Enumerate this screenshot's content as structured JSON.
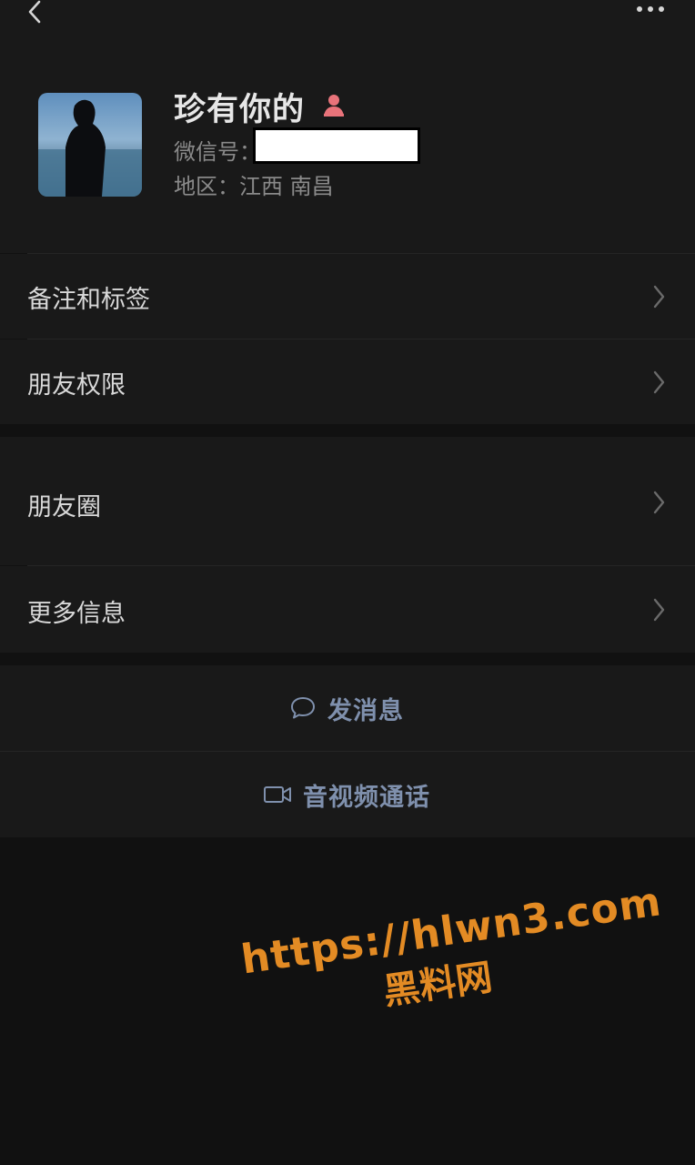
{
  "profile": {
    "name": "珍有你的",
    "wechat_id_label": "微信号：",
    "region": "地区：江西 南昌"
  },
  "menu": {
    "remarks_tags": "备注和标签",
    "friend_permissions": "朋友权限",
    "moments": "朋友圈",
    "more_info": "更多信息"
  },
  "actions": {
    "send_message": "发消息",
    "video_call": "音视频通话"
  },
  "watermark": {
    "url": "https://hlwn3.com",
    "name": "黑料网"
  },
  "colors": {
    "background": "#111111",
    "card": "#191919",
    "action_text": "#7f90ad",
    "watermark": "#e38b24",
    "gender_female": "#e8737a"
  },
  "icons": [
    "back-icon",
    "more-icon",
    "female-icon",
    "chevron-right-icon",
    "chat-bubble-icon",
    "video-camera-icon"
  ]
}
